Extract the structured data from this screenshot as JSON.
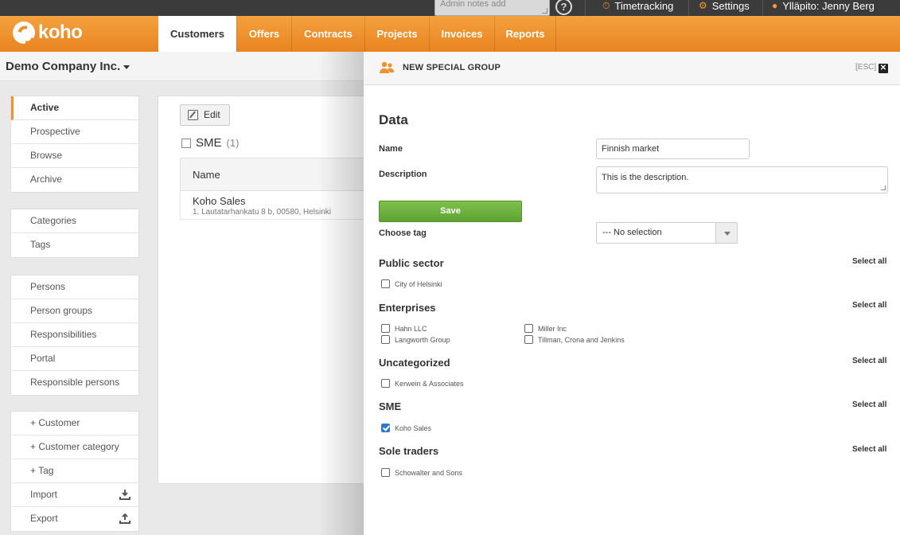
{
  "topbar": {
    "admin_notes_placeholder": "Admin notes add",
    "help_icon": "?",
    "timetracking": "Timetracking",
    "settings": "Settings",
    "user": "Ylläpito: Jenny Berg"
  },
  "logo": {
    "text": "koho"
  },
  "nav": {
    "tabs": [
      "Customers",
      "Offers",
      "Contracts",
      "Projects",
      "Invoices",
      "Reports"
    ],
    "active": "Customers"
  },
  "company": {
    "name": "Demo Company Inc."
  },
  "sidebar": {
    "group1": [
      "Active",
      "Prospective",
      "Browse",
      "Archive"
    ],
    "group2": [
      "Categories",
      "Tags"
    ],
    "group3": [
      "Persons",
      "Person groups",
      "Responsibilities",
      "Portal",
      "Responsible persons"
    ],
    "group4": [
      "+ Customer",
      "+ Customer category",
      "+ Tag",
      "Import",
      "Export"
    ]
  },
  "main": {
    "edit_label": "Edit",
    "group_name": "SME",
    "group_count": "(1)",
    "table_header": "Name",
    "row": {
      "name": "Koho Sales",
      "address": "1, Lautatarhankatu 8 b, 00580, Helsinki"
    }
  },
  "modal": {
    "title": "NEW SPECIAL GROUP",
    "esc": "[ESC]",
    "close": "✕",
    "section": "Data",
    "name_label": "Name",
    "name_value": "Finnish market",
    "description_label": "Description",
    "description_value": "This is the description.",
    "save_label": "Save",
    "choose_tag_label": "Choose tag",
    "choose_tag_value": "--- No selection",
    "select_all": "Select all",
    "groups": {
      "public_sector": {
        "title": "Public sector",
        "items": [
          "City of Helsinki"
        ]
      },
      "enterprises": {
        "title": "Enterprises",
        "items": [
          "Hahn LLC",
          "Langworth Group",
          "Miller Inc",
          "Tillman, Crona and Jenkins"
        ]
      },
      "uncategorized": {
        "title": "Uncategorized",
        "items": [
          "Kerwein & Associates"
        ]
      },
      "sme": {
        "title": "SME",
        "items": [
          "Koho Sales"
        ]
      },
      "sole_traders": {
        "title": "Sole traders",
        "items": [
          "Schowalter and Sons"
        ]
      }
    }
  }
}
